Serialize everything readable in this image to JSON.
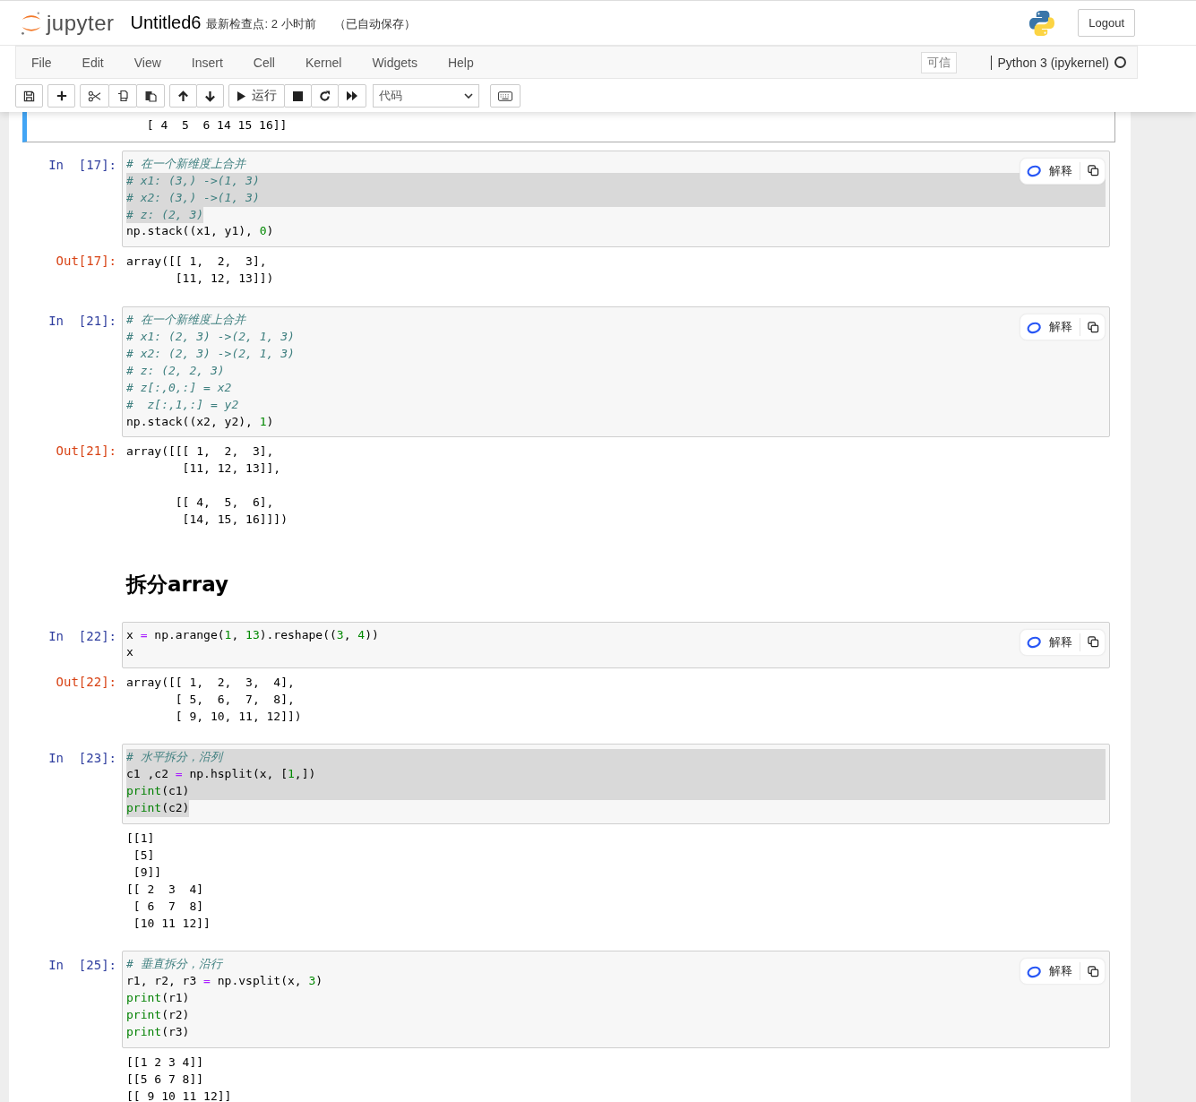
{
  "header": {
    "logo_text": "jupyter",
    "title": "Untitled6",
    "checkpoint": "最新检查点: 2 小时前",
    "autosave": "（已自动保存）",
    "logout": "Logout"
  },
  "menu": [
    "File",
    "Edit",
    "View",
    "Insert",
    "Cell",
    "Kernel",
    "Widgets",
    "Help"
  ],
  "trusted": "可信",
  "kernel": {
    "name": "Python 3 (ipykernel)",
    "busy": false
  },
  "toolbar": {
    "run": "运行",
    "cell_type": "代码"
  },
  "cells": [
    {
      "kind": "tail",
      "selected": true,
      "output": " [ 4  5  6 14 15 16]]"
    },
    {
      "kind": "code",
      "selected": false,
      "prompt": "In  [17]:",
      "explain": "解释",
      "lines": [
        {
          "selected": false,
          "tokens": [
            {
              "kind": "comment",
              "text": "# 在一个新维度上合并"
            }
          ]
        },
        {
          "selected": true,
          "tokens": [
            {
              "kind": "comment",
              "text": "# x1: (3,) ->(1, 3)"
            }
          ]
        },
        {
          "selected": true,
          "tokens": [
            {
              "kind": "comment",
              "text": "# x2: (3,) ->(1, 3)"
            }
          ]
        },
        {
          "selected": true,
          "tokens": [
            {
              "kind": "comment",
              "text": "# z: (2, 3)"
            }
          ]
        },
        {
          "selected": false,
          "tokens": [
            {
              "kind": "plain",
              "text": "np.stack((x1, y1), "
            },
            {
              "kind": "number",
              "text": "0"
            },
            {
              "kind": "plain",
              "text": ")"
            }
          ]
        }
      ],
      "out_prompt": "Out[17]:",
      "output": "array([[ 1,  2,  3],\n       [11, 12, 13]])"
    },
    {
      "kind": "code",
      "selected": false,
      "prompt": "In  [21]:",
      "explain": "解释",
      "lines": [
        {
          "selected": false,
          "tokens": [
            {
              "kind": "comment",
              "text": "# 在一个新维度上合并"
            }
          ]
        },
        {
          "selected": false,
          "tokens": [
            {
              "kind": "comment",
              "text": "# x1: (2, 3) ->(2, 1, 3)"
            }
          ]
        },
        {
          "selected": false,
          "tokens": [
            {
              "kind": "comment",
              "text": "# x2: (2, 3) ->(2, 1, 3)"
            }
          ]
        },
        {
          "selected": false,
          "tokens": [
            {
              "kind": "comment",
              "text": "# z: (2, 2, 3)"
            }
          ]
        },
        {
          "selected": false,
          "tokens": [
            {
              "kind": "comment",
              "text": "# z[:,0,:] = x2"
            }
          ]
        },
        {
          "selected": false,
          "tokens": [
            {
              "kind": "comment",
              "text": "#  z[:,1,:] = y2"
            }
          ]
        },
        {
          "selected": false,
          "tokens": [
            {
              "kind": "plain",
              "text": "np.stack((x2, y2), "
            },
            {
              "kind": "number",
              "text": "1"
            },
            {
              "kind": "plain",
              "text": ")"
            }
          ]
        }
      ],
      "out_prompt": "Out[21]:",
      "output": "array([[[ 1,  2,  3],\n        [11, 12, 13]],\n\n       [[ 4,  5,  6],\n        [14, 15, 16]]])"
    },
    {
      "kind": "markdown",
      "selected": false,
      "heading": "拆分array"
    },
    {
      "kind": "code",
      "selected": false,
      "prompt": "In  [22]:",
      "explain": "解释",
      "lines": [
        {
          "selected": false,
          "tokens": [
            {
              "kind": "plain",
              "text": "x "
            },
            {
              "kind": "operator",
              "text": "="
            },
            {
              "kind": "plain",
              "text": " np.arange("
            },
            {
              "kind": "number",
              "text": "1"
            },
            {
              "kind": "plain",
              "text": ", "
            },
            {
              "kind": "number",
              "text": "13"
            },
            {
              "kind": "plain",
              "text": ").reshape(("
            },
            {
              "kind": "number",
              "text": "3"
            },
            {
              "kind": "plain",
              "text": ", "
            },
            {
              "kind": "number",
              "text": "4"
            },
            {
              "kind": "plain",
              "text": "))"
            }
          ]
        },
        {
          "selected": false,
          "tokens": [
            {
              "kind": "plain",
              "text": "x"
            }
          ]
        }
      ],
      "out_prompt": "Out[22]:",
      "output": "array([[ 1,  2,  3,  4],\n       [ 5,  6,  7,  8],\n       [ 9, 10, 11, 12]])"
    },
    {
      "kind": "code",
      "selected": false,
      "prompt": "In  [23]:",
      "lines": [
        {
          "selected": true,
          "tokens": [
            {
              "kind": "comment",
              "text": "# 水平拆分，沿列"
            }
          ]
        },
        {
          "selected": true,
          "tokens": [
            {
              "kind": "plain",
              "text": "c1 ,c2 "
            },
            {
              "kind": "operator",
              "text": "="
            },
            {
              "kind": "plain",
              "text": " np.hsplit(x, ["
            },
            {
              "kind": "number",
              "text": "1"
            },
            {
              "kind": "plain",
              "text": ",])"
            }
          ]
        },
        {
          "selected": true,
          "tokens": [
            {
              "kind": "builtin",
              "text": "print"
            },
            {
              "kind": "plain",
              "text": "(c1)"
            }
          ]
        },
        {
          "selected": true,
          "tokens": [
            {
              "kind": "builtin",
              "text": "print"
            },
            {
              "kind": "plain",
              "text": "(c2)"
            }
          ]
        }
      ],
      "output": "[[1]\n [5]\n [9]]\n[[ 2  3  4]\n [ 6  7  8]\n [10 11 12]]"
    },
    {
      "kind": "code",
      "selected": false,
      "prompt": "In  [25]:",
      "explain": "解释",
      "lines": [
        {
          "selected": false,
          "tokens": [
            {
              "kind": "comment",
              "text": "# 垂直拆分，沿行"
            }
          ]
        },
        {
          "selected": false,
          "tokens": [
            {
              "kind": "plain",
              "text": "r1, r2, r3 "
            },
            {
              "kind": "operator",
              "text": "="
            },
            {
              "kind": "plain",
              "text": " np.vsplit(x, "
            },
            {
              "kind": "number",
              "text": "3"
            },
            {
              "kind": "plain",
              "text": ")"
            }
          ]
        },
        {
          "selected": false,
          "tokens": [
            {
              "kind": "builtin",
              "text": "print"
            },
            {
              "kind": "plain",
              "text": "(r1)"
            }
          ]
        },
        {
          "selected": false,
          "tokens": [
            {
              "kind": "builtin",
              "text": "print"
            },
            {
              "kind": "plain",
              "text": "(r2)"
            }
          ]
        },
        {
          "selected": false,
          "tokens": [
            {
              "kind": "builtin",
              "text": "print"
            },
            {
              "kind": "plain",
              "text": "(r3)"
            }
          ]
        }
      ],
      "output": "[[1 2 3 4]]\n[[5 6 7 8]]\n[[ 9 10 11 12]]"
    }
  ]
}
